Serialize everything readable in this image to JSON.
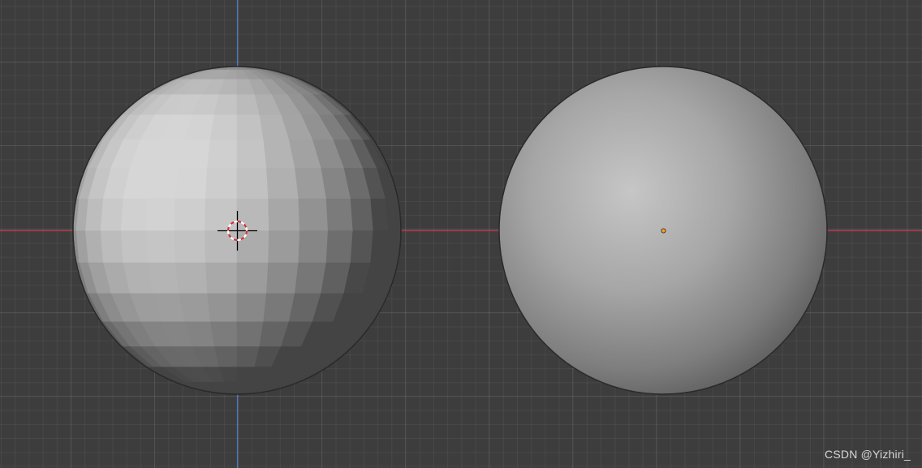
{
  "viewport": {
    "background_color": "#3d3d3d",
    "x_axis_color": "#c0394e",
    "y_axis_color": "#4a78c0",
    "objects": [
      {
        "name": "flat-shaded-uv-sphere",
        "shading": "flat",
        "selected": false
      },
      {
        "name": "smooth-shaded-uv-sphere",
        "shading": "smooth",
        "selected": true
      }
    ],
    "origin_dot_color": "#ff9d1e",
    "cursor_icon": "3d-cursor-icon"
  },
  "watermark": {
    "text": "CSDN @Yizhiri_"
  }
}
